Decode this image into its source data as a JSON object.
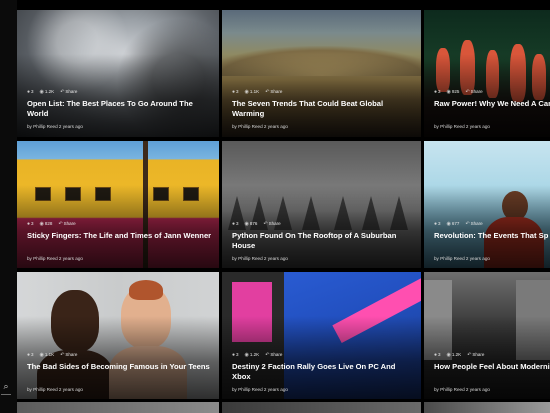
{
  "sidebar": {
    "search_icon": "search-icon"
  },
  "cards": [
    {
      "title": "Open List: The Best Places To Go Around The World",
      "byline": "by Phillip Reed 2 years ago",
      "meta": {
        "comments": "3",
        "views": "1.2K",
        "share": "Share"
      }
    },
    {
      "title": "The Seven Trends That Could Beat Global Warming",
      "byline": "by Phillip Reed 2 years ago",
      "meta": {
        "comments": "3",
        "views": "1.1K",
        "share": "Share"
      }
    },
    {
      "title": "Raw Power! Why We Need A Can For Real Cheese",
      "byline": "by Phillip Reed 2 years ago",
      "meta": {
        "comments": "3",
        "views": "925",
        "share": "Share"
      }
    },
    {
      "title": "Sticky Fingers: The Life and Times of Jann Wenner",
      "byline": "by Phillip Reed 2 years ago",
      "meta": {
        "comments": "3",
        "views": "828",
        "share": "Share"
      }
    },
    {
      "title": "Python Found On The Rooftop of A Suburban House",
      "byline": "by Phillip Reed 2 years ago",
      "meta": {
        "comments": "3",
        "views": "876",
        "share": "Share"
      }
    },
    {
      "title": "Revolution: The Events That Sp Angry Years",
      "byline": "by Phillip Reed 2 years ago",
      "meta": {
        "comments": "3",
        "views": "677",
        "share": "Share"
      }
    },
    {
      "title": "The Bad Sides of Becoming Famous in Your Teens",
      "byline": "by Phillip Reed 2 years ago",
      "meta": {
        "comments": "3",
        "views": "1.1K",
        "share": "Share"
      }
    },
    {
      "title": "Destiny 2 Faction Rally Goes Live On PC And Xbox",
      "byline": "by Phillip Reed 2 years ago",
      "meta": {
        "comments": "3",
        "views": "1.2K",
        "share": "Share"
      }
    },
    {
      "title": "How People Feel About Moderni America, In Charts",
      "byline": "by Phillip Reed 2 years ago",
      "meta": {
        "comments": "3",
        "views": "1.2K",
        "share": "Share"
      }
    }
  ]
}
